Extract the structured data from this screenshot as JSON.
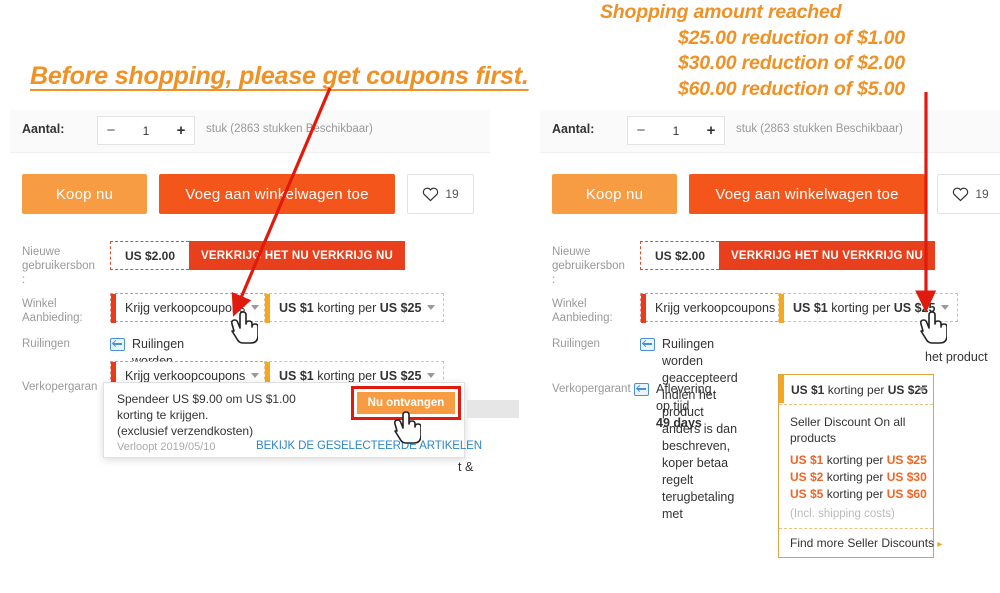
{
  "annotations": {
    "left_headline": "Before shopping, please get coupons first.",
    "right_headline_title": "Shopping amount reached",
    "right_headline_lines": [
      "$25.00 reduction of $1.00",
      "$30.00 reduction of $2.00",
      "$60.00 reduction of $5.00"
    ],
    "color": "#ef9125",
    "arrow_color": "#e01b0e"
  },
  "product": {
    "quantity": {
      "label": "Aantal:",
      "minus": "−",
      "value": "1",
      "plus": "+",
      "stock_text": "stuk (2863 stukken Beschikbaar)"
    },
    "actions": {
      "buy_now": "Koop nu",
      "add_to_cart": "Voeg aan winkelwagen toe",
      "wishlist_count": "19",
      "wishlist_icon": "heart-icon"
    },
    "rows": {
      "new_user_label": "Nieuwe gebruikersbon :",
      "new_user_amount": "US $2.00",
      "new_user_action": "VERKRIJG HET NU VERKRIJG NU",
      "store_offer_label": "Winkel Aanbieding:",
      "get_coupons_chip": "Krijg verkoopcoupons",
      "discount_chip_pre": "US $1",
      "discount_chip_mid": " korting per ",
      "discount_chip_post": "US $25",
      "exchange_label": "Ruilingen",
      "exchange_icon": "exchange-box-icon",
      "exchange_text_left": "Ruilingen worden geaccepteerd indien het product anders is dan",
      "exchange_text_right_l1": "Ruilingen worden geaccepteerd indien het product anders is dan",
      "exchange_text_right_l2": "beschreven, koper betaa",
      "exchange_text_right_l3": "regelt terugbetaling met",
      "guarantee_label": "Verkopergaran",
      "guarantee_label_right": "Verkopergarant",
      "guarantee_icon": "delivery-icon",
      "guarantee_text": "Aflevering op tijd",
      "guarantee_days": "49 days",
      "clipped_left_fragment": "t &",
      "clipped_right_fragment": "het product"
    }
  },
  "coupon_popup": {
    "line1": "Spendeer US $9.00 om US $1.00 korting te",
    "line2": "krijgen.",
    "line3": "(exclusief verzendkosten)",
    "expires": "Verloopt 2019/05/10",
    "link": "BEKIJK DE GESELECTEERDE ARTIKELEN",
    "button": "Nu ontvangen",
    "highlight_color": "#e01b0e"
  },
  "seller_dropdown": {
    "header_pre": "US $1",
    "header_mid": " korting per ",
    "header_post": "US $25",
    "title": "Seller Discount On all products",
    "tiers": [
      {
        "amount": "US $1",
        "mid": " korting per ",
        "threshold": "US $25"
      },
      {
        "amount": "US $2",
        "mid": " korting per ",
        "threshold": "US $30"
      },
      {
        "amount": "US $5",
        "mid": " korting per ",
        "threshold": "US $60"
      }
    ],
    "note": "(Incl. shipping costs)",
    "footer": "Find more Seller Discounts",
    "footer_arrow": "▸",
    "border_color": "#e0a33d",
    "tier_color": "#f26522"
  }
}
